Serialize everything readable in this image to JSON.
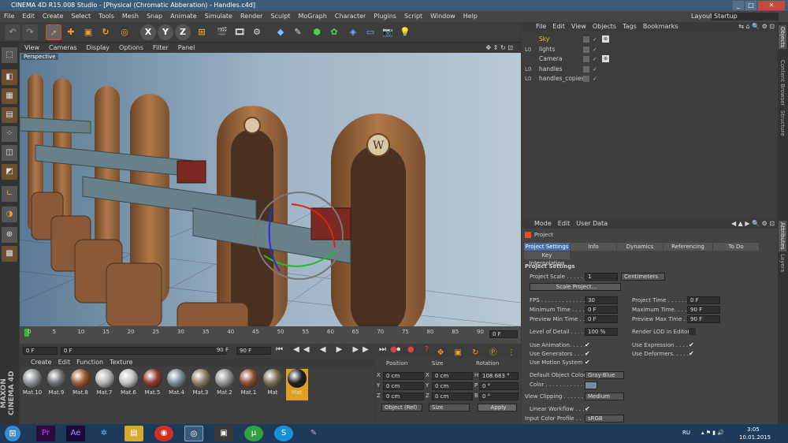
{
  "window": {
    "title": "CINEMA 4D R15.008 Studio - [Physical (Chromatic Abberation) - Handles.c4d]"
  },
  "menubar": {
    "items": [
      "File",
      "Edit",
      "Create",
      "Select",
      "Tools",
      "Mesh",
      "Snap",
      "Animate",
      "Simulate",
      "Render",
      "Sculpt",
      "MoGraph",
      "Character",
      "Plugins",
      "Script",
      "Window",
      "Help"
    ],
    "layout_label": "Layout:",
    "layout_value": "Startup"
  },
  "toolbar": {
    "axis_x": "X",
    "axis_y": "Y",
    "axis_z": "Z"
  },
  "viewport": {
    "menu": [
      "View",
      "Cameras",
      "Display",
      "Options",
      "Filter",
      "Panel"
    ],
    "label": "Perspective"
  },
  "timeline": {
    "ticks": [
      "0",
      "5",
      "10",
      "15",
      "20",
      "25",
      "30",
      "35",
      "40",
      "45",
      "50",
      "55",
      "60",
      "65",
      "70",
      "75",
      "80",
      "85",
      "90"
    ],
    "current_frame": "0 F"
  },
  "playback": {
    "start": "0 F",
    "start2": "0 F",
    "end": "90 F",
    "end2": "90 F"
  },
  "materials": {
    "menu": [
      "Create",
      "Edit",
      "Function",
      "Texture"
    ],
    "items": [
      {
        "name": "Mat.10",
        "color": "#8a8e90"
      },
      {
        "name": "Mat.9",
        "color": "#6b6e70"
      },
      {
        "name": "Mat.8",
        "color": "#9a5a30"
      },
      {
        "name": "Mat.7",
        "color": "#b0b0b0"
      },
      {
        "name": "Mat.6",
        "color": "#c0c0c0"
      },
      {
        "name": "Mat.5",
        "color": "#8a3a2a"
      },
      {
        "name": "Mat.4",
        "color": "#7a8a90"
      },
      {
        "name": "Mat.3",
        "color": "#8a7a68"
      },
      {
        "name": "Mat.2",
        "color": "#909090"
      },
      {
        "name": "Mat.1",
        "color": "#8a4a30"
      },
      {
        "name": "Mat",
        "color": "#7a6a50"
      },
      {
        "name": "Mat",
        "color": "#202020"
      }
    ],
    "side_logo": "MAXON CINEMA 4D"
  },
  "coordinates": {
    "headers": [
      "Position",
      "Size",
      "Rotation"
    ],
    "rows": [
      {
        "axis": "X",
        "pos": "0 cm",
        "saxis": "X",
        "size": "0 cm",
        "raxis": "H",
        "rot": "108.683 °"
      },
      {
        "axis": "Y",
        "pos": "0 cm",
        "saxis": "Y",
        "size": "0 cm",
        "raxis": "P",
        "rot": "0 °"
      },
      {
        "axis": "Z",
        "pos": "0 cm",
        "saxis": "Z",
        "size": "0 cm",
        "raxis": "B",
        "rot": "0 °"
      }
    ],
    "mode": "Object (Rel)",
    "size_mode": "Size",
    "apply": "Apply"
  },
  "objects": {
    "menu": [
      "File",
      "Edit",
      "View",
      "Objects",
      "Tags",
      "Bookmarks"
    ],
    "rows": [
      {
        "name": "Sky",
        "prefix": "",
        "color": "#e8c040"
      },
      {
        "name": "lights",
        "prefix": "L0",
        "color": "#d0d0d0"
      },
      {
        "name": "Camera",
        "prefix": "",
        "color": "#d0d0d0"
      },
      {
        "name": "handles",
        "prefix": "L0",
        "color": "#d0d0d0"
      },
      {
        "name": "handles_copies",
        "prefix": "L0",
        "color": "#d0d0d0"
      }
    ]
  },
  "attributes": {
    "menu": [
      "Mode",
      "Edit",
      "User Data"
    ],
    "object": "Project",
    "tabs": [
      "Project Settings",
      "Info",
      "Dynamics",
      "Referencing",
      "To Do",
      "Key Interpolation"
    ],
    "section": "Project Settings",
    "scale_label": "Project Scale . . . . . .",
    "scale_value": "1",
    "scale_unit": "Centimeters",
    "scale_button": "Scale Project...",
    "fps_label": "FPS . . . . . . . . . . . . .",
    "fps": "30",
    "project_time_label": "Project Time . . . . . . .",
    "project_time": "0 F",
    "min_time_label": "Minimum Time . . . . .",
    "min_time": "0 F",
    "max_time_label": "Maximum Time. . . . .",
    "max_time": "90 F",
    "preview_min_label": "Preview Min Time . .",
    "preview_min": "0 F",
    "preview_max_label": "Preview Max Time . .",
    "preview_max": "90 F",
    "lod_label": "Level of Detail . . . . .",
    "lod": "100 %",
    "render_lod_label": "Render LOD in Editor",
    "use_animation": "Use Animation. . . . .",
    "use_expression": "Use Expression . . . .",
    "use_generators": "Use Generators . . . .",
    "use_deformers": "Use Deformers. . . . .",
    "use_motion": "Use Motion System",
    "default_color_label": "Default Object Color",
    "default_color": "Gray-Blue",
    "color_label": "Color . . . . . . . . . . .",
    "view_clipping_label": "View Clipping . . . . . .",
    "view_clipping": "Medium",
    "linear_workflow": "Linear Workflow . . . .",
    "input_profile_label": "Input Color Profile . .",
    "input_profile": "sRGB"
  },
  "sidetabs": [
    "Objects",
    "Content Browser",
    "Structure",
    "Attributes",
    "Layers"
  ],
  "taskbar": {
    "lang": "RU",
    "time": "3:05",
    "date": "10.01.2015"
  }
}
